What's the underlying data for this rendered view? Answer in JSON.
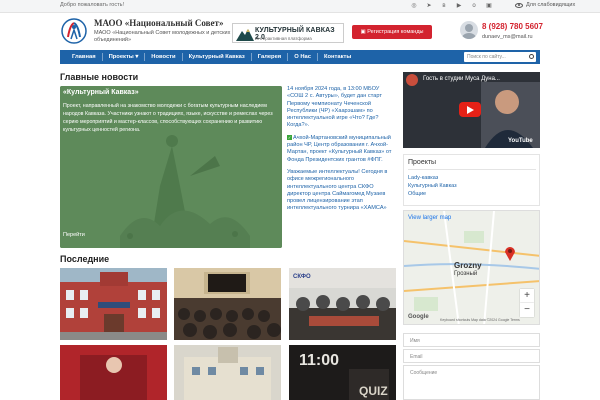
{
  "topbar": {
    "welcome": "Добро пожаловать гость!",
    "socials": [
      "whatsapp-icon",
      "telegram-icon",
      "vk-icon",
      "youtube-icon",
      "ok-icon",
      "rutube-icon"
    ],
    "impaired_label": "Для слабовидящих"
  },
  "header": {
    "org_name": "МАОО «Национальный Совет»",
    "org_sub": "МАОО «Национальный Совет молодежных и детских объединений»",
    "banner_title": "КУЛЬТУРНЫЙ КАВКАЗ 2.0",
    "banner_sub": "Интерактивная платформа",
    "register_button": "Регистрация команды",
    "phone": "8 (928) 780 5607",
    "email": "dunaev_ms@mail.ru"
  },
  "nav": {
    "items": [
      "Главная",
      "Проекты ▾",
      "Новости",
      "Культурный Кавказ",
      "Галерея",
      "О Нас",
      "Контакты"
    ],
    "search_placeholder": "Поиск по сайту..."
  },
  "main": {
    "heading": "Главные новости",
    "feature": {
      "title": "«Культурный Кавказ»",
      "description": "Проект, направленный на знакомство молодежи с богатым культурным наследием народов Кавказа. Участники узнают о традициях, языке, искусстве и ремеслах через серию мероприятий и мастер-классов, способствующих сохранению и развитию культурных ценностей региона.",
      "more": "Перейти"
    },
    "news": [
      "14 ноября 2024 года, в 13:00 МБОУ «СОШ 2 с. Автуры», будет дан старт Первому чемпионату Чеченской Республики (ЧР) «Хаарэшам» по интеллектуальной игре «Что? Где? Когда?».",
      "Ачхой-Мартановский муниципальный район ЧР, Центр образования г. Ачхой-Мартан, проект «Культурный Кавказ» от Фонда Президентских грантов #ФПГ.",
      "Уважаемые интеллектуалы! Сегодня в офисе межрегионального интеллектуального центра СКФО директор центра Саймагомед Музаев провел лицензирование этап интеллектуального турнира «ХАМСА»"
    ],
    "recent_heading": "Последние"
  },
  "sidebar": {
    "video_title": "Гость в студии Муса Дуна...",
    "video_brand": "YouTube",
    "projects_heading": "Проекты",
    "projects": [
      "Lady-кавказ",
      "Культурный Кавказ",
      "Общие"
    ],
    "map": {
      "view_larger": "View larger map",
      "city_label_1": "Grozny",
      "city_label_2": "Грозный",
      "footer": "Keyboard shortcuts   Map data ©2024 Google   Terms",
      "google": "Google"
    },
    "form": {
      "name": "Имя",
      "email": "Email",
      "message": "Сообщение"
    }
  },
  "colors": {
    "brand_blue": "#1e63a8",
    "accent_red": "#d3232f",
    "feature_green": "#5e8a5a"
  }
}
